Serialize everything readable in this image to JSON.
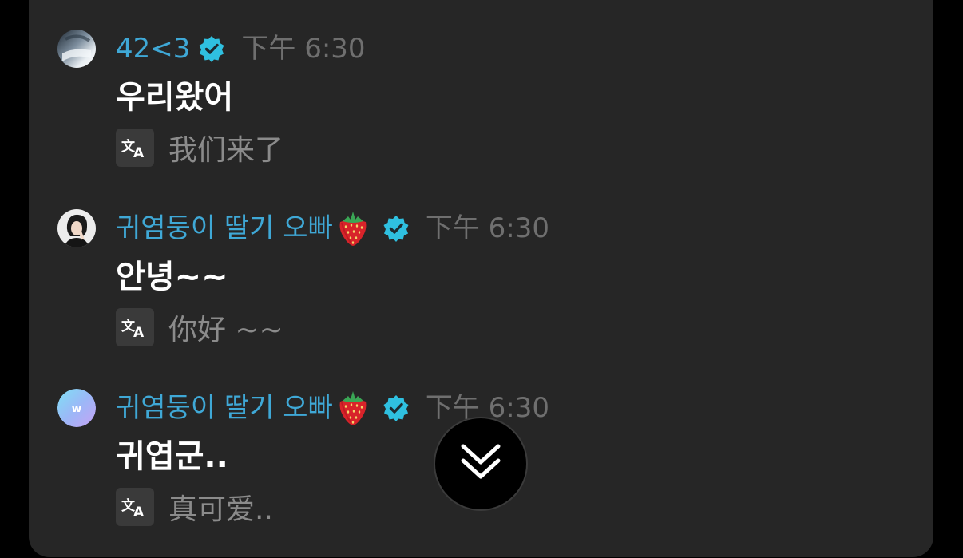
{
  "messages": [
    {
      "username": "42<3",
      "verified": true,
      "strawberry": false,
      "avatar": "profile-photo-1",
      "time": "下午 6:30",
      "text": "우리왔어",
      "translation": "我们来了"
    },
    {
      "username": "귀염둥이 딸기 오빠",
      "verified": true,
      "strawberry": true,
      "avatar": "profile-photo-2",
      "time": "下午 6:30",
      "text": "안녕~~",
      "translation": "你好 ~~"
    },
    {
      "username": "귀염둥이 딸기 오빠",
      "verified": true,
      "strawberry": true,
      "avatar": "weverse-logo",
      "time": "下午 6:30",
      "text": "귀엽군..",
      "translation": "真可爱.."
    }
  ],
  "icons": {
    "verified": "verified-badge-icon",
    "translate": "translate-icon",
    "scroll": "double-chevron-down-icon",
    "strawberry": "strawberry-emoji"
  },
  "colors": {
    "background": "#000000",
    "panel": "#262626",
    "username": "#3fa8d6",
    "verified": "#2fc0e0",
    "message": "#ffffff",
    "timestamp": "#6f6f6f",
    "translation": "#8b8b8b"
  }
}
